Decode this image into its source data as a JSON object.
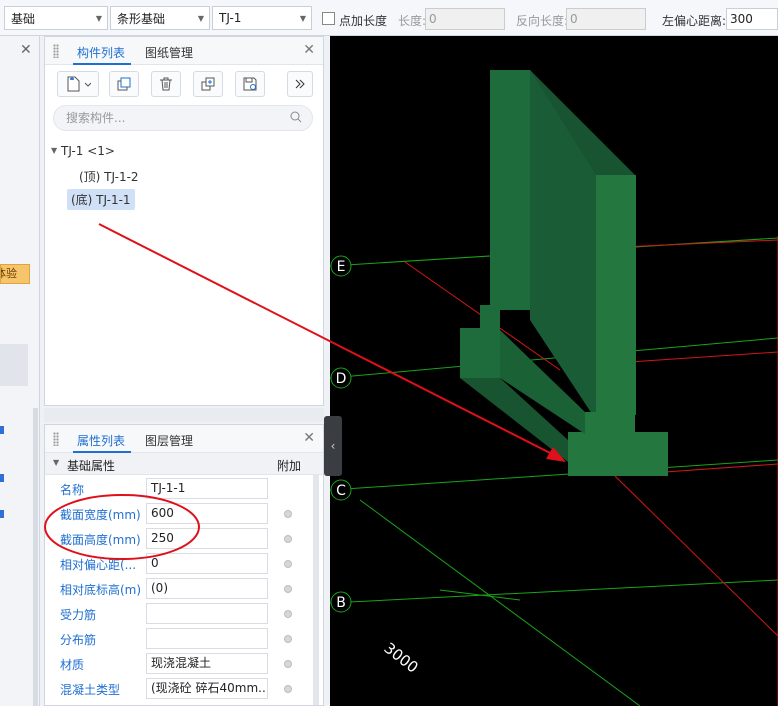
{
  "toolbar": {
    "category": "基础",
    "type": "条形基础",
    "component": "TJ-1",
    "point_length_label": "点加长度",
    "length_label": "长度:",
    "length_value": "0",
    "reverse_length_label": "反向长度:",
    "reverse_length_value": "0",
    "left_offset_label": "左偏心距离:",
    "left_offset_value": "300"
  },
  "left_strip": {
    "badge": "体验"
  },
  "component_panel": {
    "tabs": [
      "构件列表",
      "图纸管理"
    ],
    "search_placeholder": "搜索构件...",
    "tree": {
      "root": "TJ-1 <1>",
      "children": [
        "(顶) TJ-1-2",
        "(底) TJ-1-1"
      ]
    }
  },
  "property_panel": {
    "tabs": [
      "属性列表",
      "图层管理"
    ],
    "group": "基础属性",
    "extra_header": "附加",
    "rows": [
      {
        "name": "名称",
        "value": "TJ-1-1"
      },
      {
        "name": "截面宽度(mm)",
        "value": "600"
      },
      {
        "name": "截面高度(mm)",
        "value": "250"
      },
      {
        "name": "相对偏心距(...",
        "value": "0"
      },
      {
        "name": "相对底标高(m)",
        "value": "(0)"
      },
      {
        "name": "受力筋",
        "value": ""
      },
      {
        "name": "分布筋",
        "value": ""
      },
      {
        "name": "材质",
        "value": "现浇混凝土"
      },
      {
        "name": "混凝土类型",
        "value": "(现浇砼 碎石40mm..."
      }
    ]
  },
  "viewport": {
    "axis_labels": [
      "E",
      "D",
      "C",
      "B"
    ],
    "dimension_label": "3000"
  },
  "colors": {
    "accent": "#1f6fd1",
    "solid_front": "#1e6b3c",
    "solid_side": "#17542f",
    "axis_green": "#1aa31a",
    "axis_red": "#d01818",
    "annotation_red": "#e0101a"
  }
}
